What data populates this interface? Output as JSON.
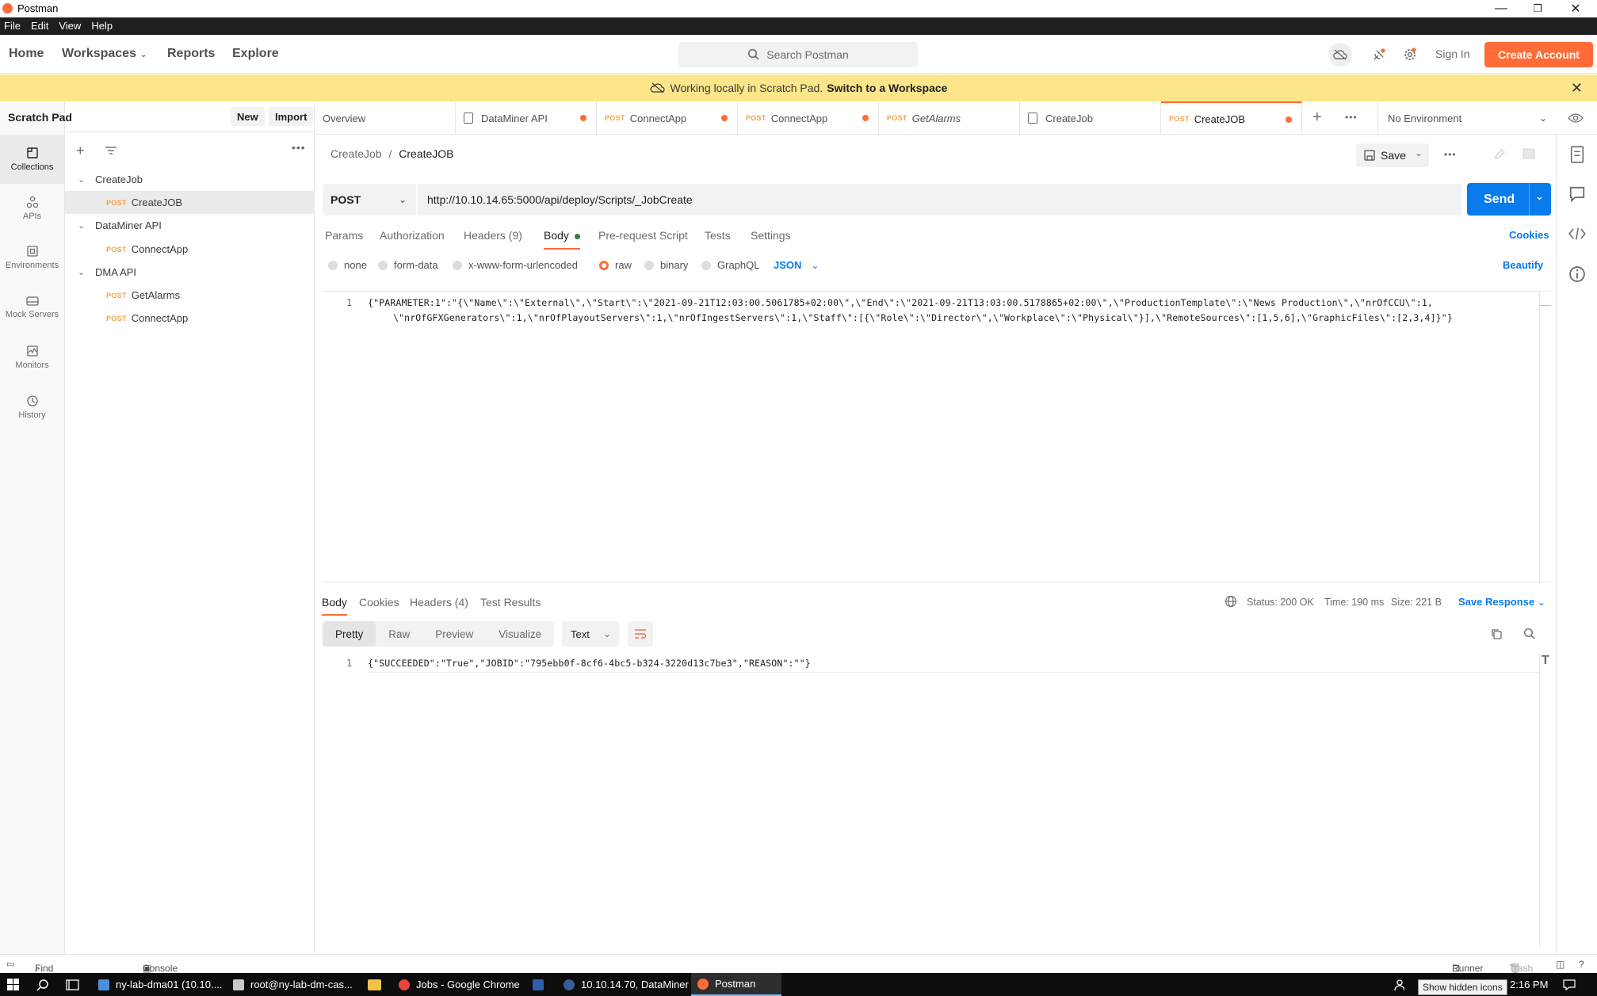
{
  "window": {
    "title": "Postman",
    "minimize": "—",
    "maximize": "❐",
    "close": "✕"
  },
  "menu": [
    "File",
    "Edit",
    "View",
    "Help"
  ],
  "header": {
    "nav": [
      "Home",
      "Workspaces",
      "Reports",
      "Explore"
    ],
    "search_placeholder": "Search Postman",
    "sign_in": "Sign In",
    "create_account": "Create Account"
  },
  "banner": {
    "text": "Working locally in Scratch Pad.",
    "link": "Switch to a Workspace"
  },
  "rail": [
    "Collections",
    "APIs",
    "Environments",
    "Mock Servers",
    "Monitors",
    "History"
  ],
  "sidebar": {
    "title": "Scratch Pad",
    "new_label": "New",
    "import_label": "Import",
    "tree": [
      {
        "type": "folder",
        "label": "CreateJob"
      },
      {
        "type": "request",
        "method": "POST",
        "label": "CreateJOB",
        "selected": true
      },
      {
        "type": "folder",
        "label": "DataMiner API"
      },
      {
        "type": "request",
        "method": "POST",
        "label": "ConnectApp"
      },
      {
        "type": "folder",
        "label": "DMA API"
      },
      {
        "type": "request",
        "method": "POST",
        "label": "GetAlarms"
      },
      {
        "type": "request",
        "method": "POST",
        "label": "ConnectApp"
      }
    ]
  },
  "tabs": [
    {
      "label": "Overview"
    },
    {
      "label": "DataMiner API",
      "icon": "doc",
      "dot": true
    },
    {
      "method": "POST",
      "label": "ConnectApp",
      "dot": true
    },
    {
      "method": "POST",
      "label": "ConnectApp",
      "dot": true
    },
    {
      "method": "POST",
      "label": "GetAlarms",
      "italic": true
    },
    {
      "label": "CreateJob",
      "icon": "doc"
    },
    {
      "method": "POST",
      "label": "CreateJOB",
      "dot": true,
      "active": true
    }
  ],
  "environment": "No Environment",
  "breadcrumb": {
    "parent": "CreateJob",
    "sep": "/",
    "current": "CreateJOB"
  },
  "save_label": "Save",
  "request": {
    "method": "POST",
    "url": "http://10.10.14.65:5000/api/deploy/Scripts/_JobCreate",
    "send_label": "Send",
    "subtabs": [
      "Params",
      "Authorization",
      "Headers (9)",
      "Body",
      "Pre-request Script",
      "Tests",
      "Settings"
    ],
    "cookies": "Cookies",
    "beautify": "Beautify",
    "body_types": [
      "none",
      "form-data",
      "x-www-form-urlencoded",
      "raw",
      "binary",
      "GraphQL"
    ],
    "body_type_selected": "raw",
    "body_lang": "JSON",
    "line_no": "1",
    "body_line1": "{\"PARAMETER:1\":\"{\\\"Name\\\":\\\"External\\\",\\\"Start\\\":\\\"2021-09-21T12:03:00.5061785+02:00\\\",\\\"End\\\":\\\"2021-09-21T13:03:00.5178865+02:00\\\",\\\"ProductionTemplate\\\":\\\"News Production\\\",\\\"nrOfCCU\\\":1,",
    "body_line2": "\\\"nrOfGFXGenerators\\\":1,\\\"nrOfPlayoutServers\\\":1,\\\"nrOfIngestServers\\\":1,\\\"Staff\\\":[{\\\"Role\\\":\\\"Director\\\",\\\"Workplace\\\":\\\"Physical\\\"}],\\\"RemoteSources\\\":[1,5,6],\\\"GraphicFiles\\\":[2,3,4]}\"}"
  },
  "response": {
    "tabs": [
      "Body",
      "Cookies",
      "Headers (4)",
      "Test Results"
    ],
    "status": "Status: 200 OK",
    "time": "Time: 190 ms",
    "size": "Size: 221 B",
    "save_response": "Save Response",
    "views": [
      "Pretty",
      "Raw",
      "Preview",
      "Visualize"
    ],
    "format": "Text",
    "line_no": "1",
    "body": "{\"SUCCEEDED\":\"True\",\"JOBID\":\"795ebb0f-8cf6-4bc5-b324-3220d13c7be3\",\"REASON\":\"\"}"
  },
  "statusbar": {
    "find_replace": "Find and Replace",
    "console": "Console",
    "runner": "Runner",
    "trash": "Trash"
  },
  "taskbar": {
    "items": [
      "ny-lab-dma01 (10.10....",
      "root@ny-lab-dm-cas...",
      "Jobs - Google Chrome",
      "10.10.14.70, DataMiner",
      "Postman"
    ],
    "time": "2:16 PM",
    "tooltip": "Show hidden icons"
  }
}
